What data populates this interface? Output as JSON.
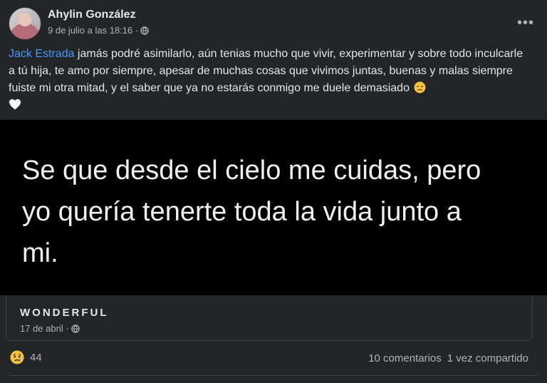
{
  "post": {
    "author": "Ahylin González",
    "timestamp": "9 de julio a las 18:16 ·",
    "privacy_icon": "globe-icon",
    "more_label": "•••",
    "mention": "Jack Estrada",
    "text": " jamás podré asimilarlo, aún tenias mucho que vivir, experimentar y sobre todo inculcarle a tú hija, te amo por siempre, apesar de muchas cosas que vivimos juntas, buenas y malas siempre fuiste mi otra mitad, y el saber que ya no estarás conmigo me duele demasiado",
    "emojis": [
      "disappointed-face",
      "white-heart"
    ]
  },
  "shared": {
    "quote_lines": [
      "Se que desde el cielo me cuidas, pero",
      "yo quería tenerte toda la vida junto a",
      "mi."
    ],
    "page_name": "WONDERFUL",
    "date": "17 de abril ·"
  },
  "footer": {
    "reaction_icon": "sad-reaction-icon",
    "reaction_count": "44",
    "comments": "10 comentarios",
    "shares": "1 vez compartido"
  },
  "colors": {
    "background": "#242526",
    "mention": "#4599ff",
    "secondary_text": "#b0b3b8"
  }
}
